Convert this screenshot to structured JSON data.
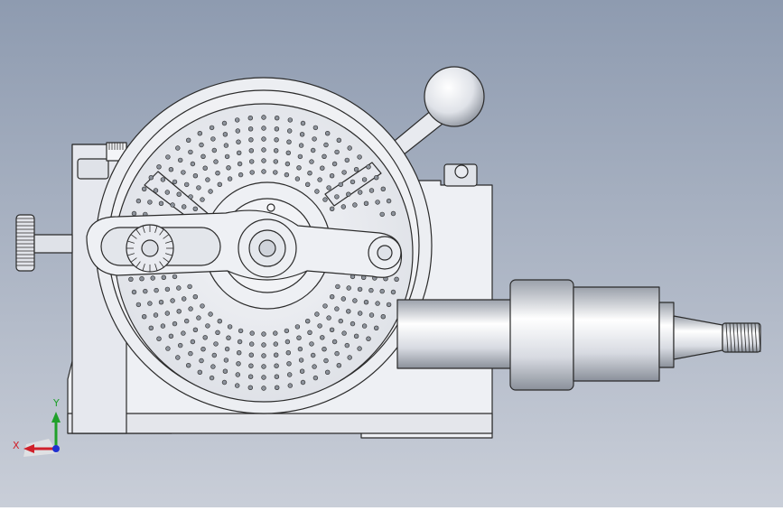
{
  "viewport": {
    "background_top": "#8e9bb0",
    "background_bottom": "#c9ced8",
    "model_color": "#eef0f4",
    "edge_color": "#2b2b2b"
  },
  "triad": {
    "x_label": "X",
    "y_label": "Y",
    "x_color": "#d0202a",
    "y_color": "#1fa02a",
    "z_color": "#2030d0"
  }
}
